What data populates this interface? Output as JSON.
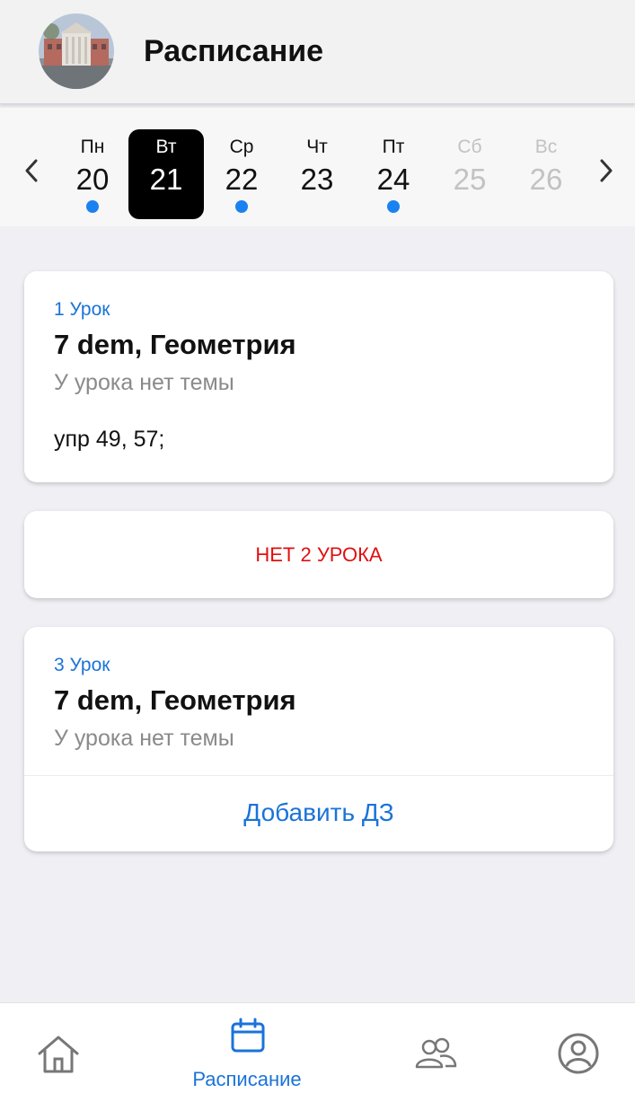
{
  "header": {
    "title": "Расписание"
  },
  "week": {
    "days": [
      {
        "name": "Пн",
        "number": "20",
        "has_lessons": true,
        "selected": false,
        "weekend": false
      },
      {
        "name": "Вт",
        "number": "21",
        "has_lessons": false,
        "selected": true,
        "weekend": false
      },
      {
        "name": "Ср",
        "number": "22",
        "has_lessons": true,
        "selected": false,
        "weekend": false
      },
      {
        "name": "Чт",
        "number": "23",
        "has_lessons": false,
        "selected": false,
        "weekend": false
      },
      {
        "name": "Пт",
        "number": "24",
        "has_lessons": true,
        "selected": false,
        "weekend": false
      },
      {
        "name": "Сб",
        "number": "25",
        "has_lessons": false,
        "selected": false,
        "weekend": true
      },
      {
        "name": "Вс",
        "number": "26",
        "has_lessons": false,
        "selected": false,
        "weekend": true
      }
    ]
  },
  "lessons": {
    "first": {
      "number": "1 Урок",
      "subject": "7 dem, Геометрия",
      "topic": "У урока нет темы",
      "homework": "упр 49, 57;"
    },
    "second": {
      "message": "НЕТ 2 УРОКА"
    },
    "third": {
      "number": "3 Урок",
      "subject": "7 dem, Геометрия",
      "topic": "У урока нет темы",
      "add_homework": "Добавить ДЗ"
    }
  },
  "tabbar": {
    "active_tab": "Расписание",
    "tabs": [
      {
        "icon": "home-icon"
      },
      {
        "icon": "calendar-icon",
        "label": "Расписание"
      },
      {
        "icon": "users-icon"
      },
      {
        "icon": "profile-icon"
      }
    ]
  },
  "colors": {
    "accent": "#1a73d9",
    "dot": "#1a82f0",
    "error": "#e01010",
    "selected_day_bg": "#000000",
    "background": "#efeff4"
  }
}
